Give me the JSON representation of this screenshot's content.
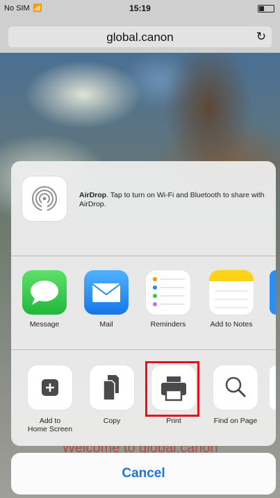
{
  "status_bar": {
    "carrier": "No SIM",
    "time": "15:19"
  },
  "browser": {
    "url": "global.canon",
    "reload_icon": "reload-icon"
  },
  "background_text": "Welcome to global.canon",
  "airdrop": {
    "title": "AirDrop",
    "description": ". Tap to turn on Wi-Fi and Bluetooth to share with AirDrop."
  },
  "apps": [
    {
      "label": "Message",
      "icon": "message-icon",
      "color": "#35c84a"
    },
    {
      "label": "Mail",
      "icon": "mail-icon",
      "color": "#1e8ef2"
    },
    {
      "label": "Reminders",
      "icon": "reminders-icon",
      "color": "#ffffff"
    },
    {
      "label": "Add to Notes",
      "icon": "notes-icon",
      "color": "#ffd21a"
    }
  ],
  "actions": [
    {
      "label": "Add to\nHome Screen",
      "icon": "add-home-icon"
    },
    {
      "label": "Copy",
      "icon": "copy-icon"
    },
    {
      "label": "Print",
      "icon": "print-icon"
    },
    {
      "label": "Find on Page",
      "icon": "search-icon"
    }
  ],
  "highlight_color": "#e0131f",
  "cancel_label": "Cancel"
}
